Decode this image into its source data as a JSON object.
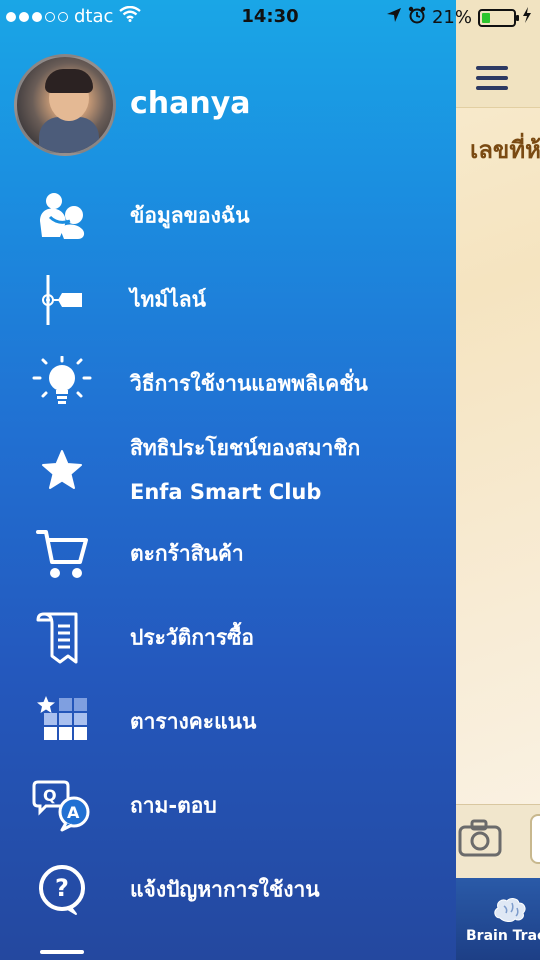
{
  "status_bar": {
    "carrier": "dtac",
    "time": "14:30",
    "battery": "21%"
  },
  "background": {
    "title": "เลขที่ห้อ",
    "tab_label": "Brain Track"
  },
  "profile": {
    "name": "chanya"
  },
  "menu": [
    {
      "label": "ข้อมูลของฉัน",
      "icon": "mother-child-icon"
    },
    {
      "label": "ไทม์ไลน์",
      "icon": "timeline-icon"
    },
    {
      "label": "วิธีการใช้งานแอพพลิเคชั่น",
      "icon": "lightbulb-icon"
    },
    {
      "label": "สิทธิประโยชน์ของสมาชิก",
      "label2": "Enfa Smart Club",
      "icon": "star-icon"
    },
    {
      "label": "ตะกร้าสินค้า",
      "icon": "cart-icon"
    },
    {
      "label": "ประวัติการซื้อ",
      "icon": "receipt-icon"
    },
    {
      "label": "ตารางคะแนน",
      "icon": "leaderboard-icon"
    },
    {
      "label": "ถาม-ตอบ",
      "icon": "qa-icon"
    },
    {
      "label": "แจ้งปัญหาการใช้งาน",
      "icon": "help-icon"
    }
  ],
  "colors": {
    "drawer_top": "#1aa6e6",
    "drawer_bottom": "#24489f",
    "text": "#ffffff"
  }
}
